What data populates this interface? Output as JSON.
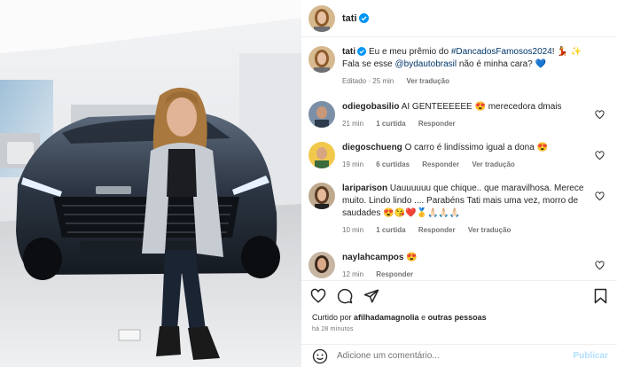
{
  "post": {
    "author": "tati",
    "caption_text": "Eu e meu prêmio do ",
    "caption_hashtag": "#DancadosFamosos2024",
    "caption_emojis": "! 💃 ✨ Fala se esse ",
    "caption_mention": "@bydautobrasil",
    "caption_end": " não é minha cara? 💙",
    "edited_label": "Editado · 25 min",
    "see_translation": "Ver tradução"
  },
  "comments": [
    {
      "username": "odiegobasilio",
      "text": "AI GENTEEEEEE 😍 merecedora dmais",
      "time": "21 min",
      "likes": "1 curtida",
      "reply": "Responder",
      "translate": ""
    },
    {
      "username": "diegoschueng",
      "text": "O carro é lindíssimo igual a dona 😍",
      "time": "19 min",
      "likes": "6 curtidas",
      "reply": "Responder",
      "translate": "Ver tradução"
    },
    {
      "username": "lariparison",
      "text": "Uauuuuuu que chique.. que maravilhosa. Merece muito. Lindo lindo .... Parabéns Tati mais uma vez, morro de saudades 😍😘❤️🥇🙏🏻🙏🏻🙏🏻",
      "time": "10 min",
      "likes": "1 curtida",
      "reply": "Responder",
      "translate": "Ver tradução"
    },
    {
      "username": "naylahcampos",
      "text": "😍",
      "time": "12 min",
      "likes": "",
      "reply": "Responder",
      "translate": ""
    }
  ],
  "footer": {
    "liked_by_prefix": "Curtido por ",
    "liked_by_user": "afilhadamagnolia",
    "liked_by_suffix": " e ",
    "liked_by_others": "outras pessoas",
    "date": "há 28 minutos",
    "comment_placeholder": "Adicione um comentário...",
    "publish_label": "Publicar"
  },
  "icons": {
    "verified": "verified-badge-icon",
    "like": "heart-icon",
    "comment": "comment-icon",
    "share": "send-icon",
    "save": "bookmark-icon",
    "emoji": "smiley-icon"
  },
  "colors": {
    "verified_blue": "#0095f6",
    "link_blue": "#00376b",
    "publish_disabled": "#b2dffc",
    "muted_text": "#737373"
  }
}
